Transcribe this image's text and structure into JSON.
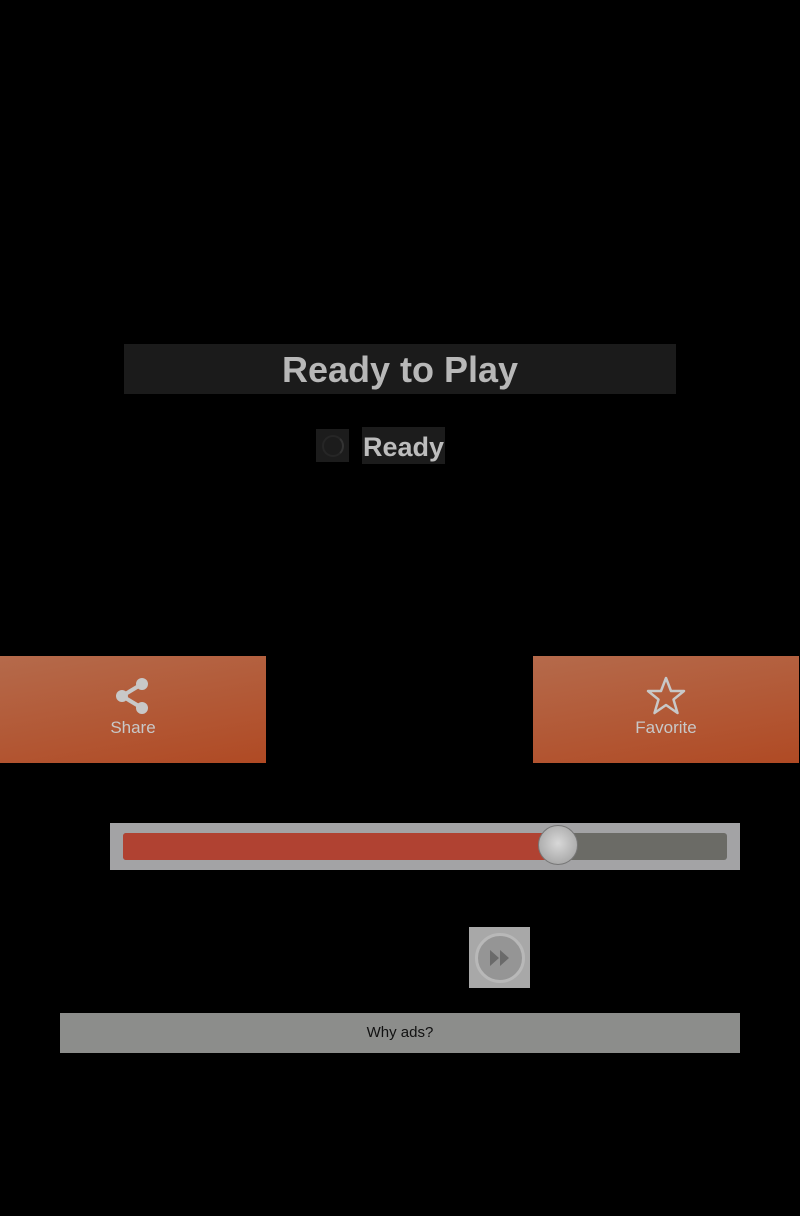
{
  "player": {
    "title": "Ready to Play",
    "status": "Ready"
  },
  "actions": {
    "share_label": "Share",
    "favorite_label": "Favorite"
  },
  "seek": {
    "progress_percent": 72
  },
  "controls": {
    "fast_forward_icon": "fast-forward-icon"
  },
  "ads": {
    "why_ads_label": "Why ads?"
  },
  "colors": {
    "accent": "#b04a24",
    "progress_fill": "#b04232"
  }
}
